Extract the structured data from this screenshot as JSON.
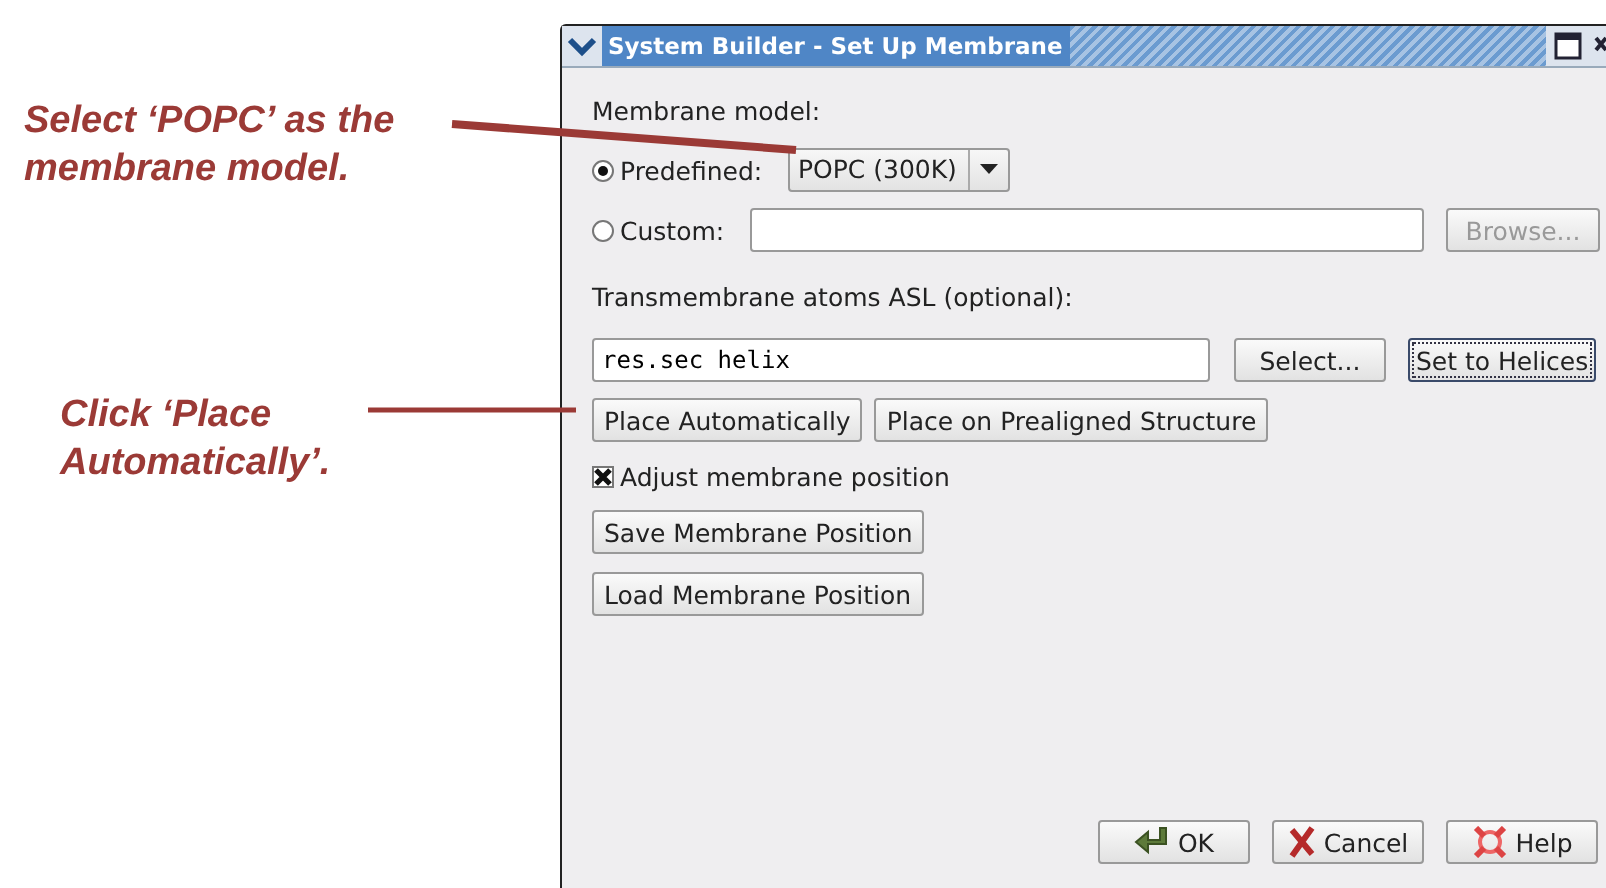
{
  "annotations": [
    {
      "text": "Select ‘POPC’ as the membrane model."
    },
    {
      "text": "Click ‘Place Automatically’."
    }
  ],
  "window": {
    "title": "System Builder - Set Up Membrane"
  },
  "membrane_model": {
    "label": "Membrane model:",
    "options": [
      {
        "label": "Predefined:",
        "selected": true
      },
      {
        "label": "Custom:",
        "selected": false
      }
    ],
    "predefined_value": "POPC (300K)",
    "browse_button": {
      "label": "Browse...",
      "disabled": true
    }
  },
  "asl": {
    "label": "Transmembrane atoms ASL (optional):",
    "value": "res.sec helix",
    "buttons": [
      {
        "label": "Select...",
        "focused": false
      },
      {
        "label": "Set to Helices",
        "focused": true
      }
    ]
  },
  "place_buttons": [
    "Place Automatically",
    "Place on Prealigned Structure"
  ],
  "adjust_checkbox": {
    "label": "Adjust membrane position",
    "checked": true
  },
  "position_buttons": [
    "Save Membrane Position",
    "Load Membrane Position"
  ],
  "footer_buttons": [
    {
      "kind": "ok",
      "label": "OK"
    },
    {
      "kind": "cancel",
      "label": "Cancel"
    },
    {
      "kind": "help",
      "label": "Help"
    }
  ]
}
